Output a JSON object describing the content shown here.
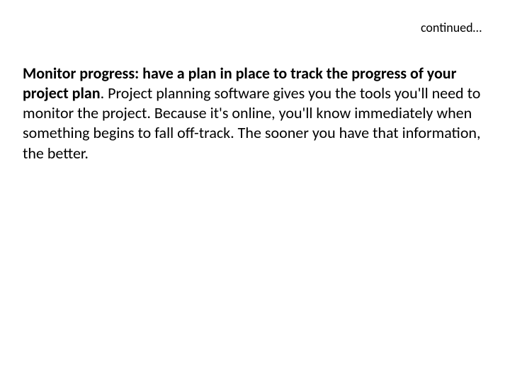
{
  "header": {
    "continued": "continued…"
  },
  "body": {
    "bold_lead": "Monitor progress: have a plan in place to track the progress of your project plan",
    "rest": ". Project planning software gives you the tools you'll need to monitor the project. Because it's online, you'll know immediately when something begins to fall off-track. The sooner you have that information, the better."
  }
}
